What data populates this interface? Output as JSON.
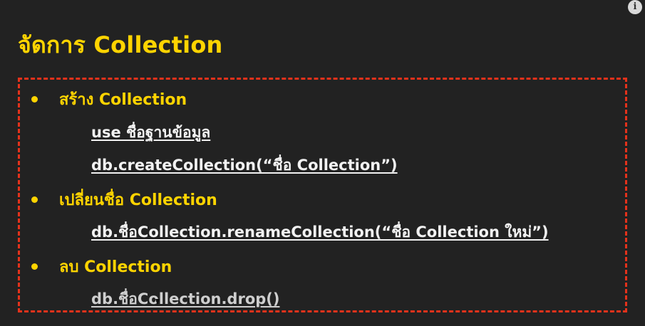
{
  "slide": {
    "title": "จัดการ Collection",
    "info_icon_label": "i",
    "sections": [
      {
        "heading": "สร้าง Collection",
        "commands": [
          "use ชื่อฐานข้อมูล",
          "db.createCollection(“ชื่อ Collection”)"
        ]
      },
      {
        "heading": "เปลี่ยนชื่อ Collection",
        "commands": [
          "db.ชื่อCollection.renameCollection(“ชื่อ Collection ใหม่”)"
        ]
      },
      {
        "heading": "ลบ Collection",
        "commands": [
          "db.ชื่อCollection.drop()"
        ]
      }
    ]
  },
  "colors": {
    "background": "#222222",
    "accent_yellow": "#ffd400",
    "dashed_border_red": "#e4321b",
    "command_text": "#f2f2f2"
  },
  "icons": [
    "info-icon",
    "mouse-cursor-icon"
  ]
}
